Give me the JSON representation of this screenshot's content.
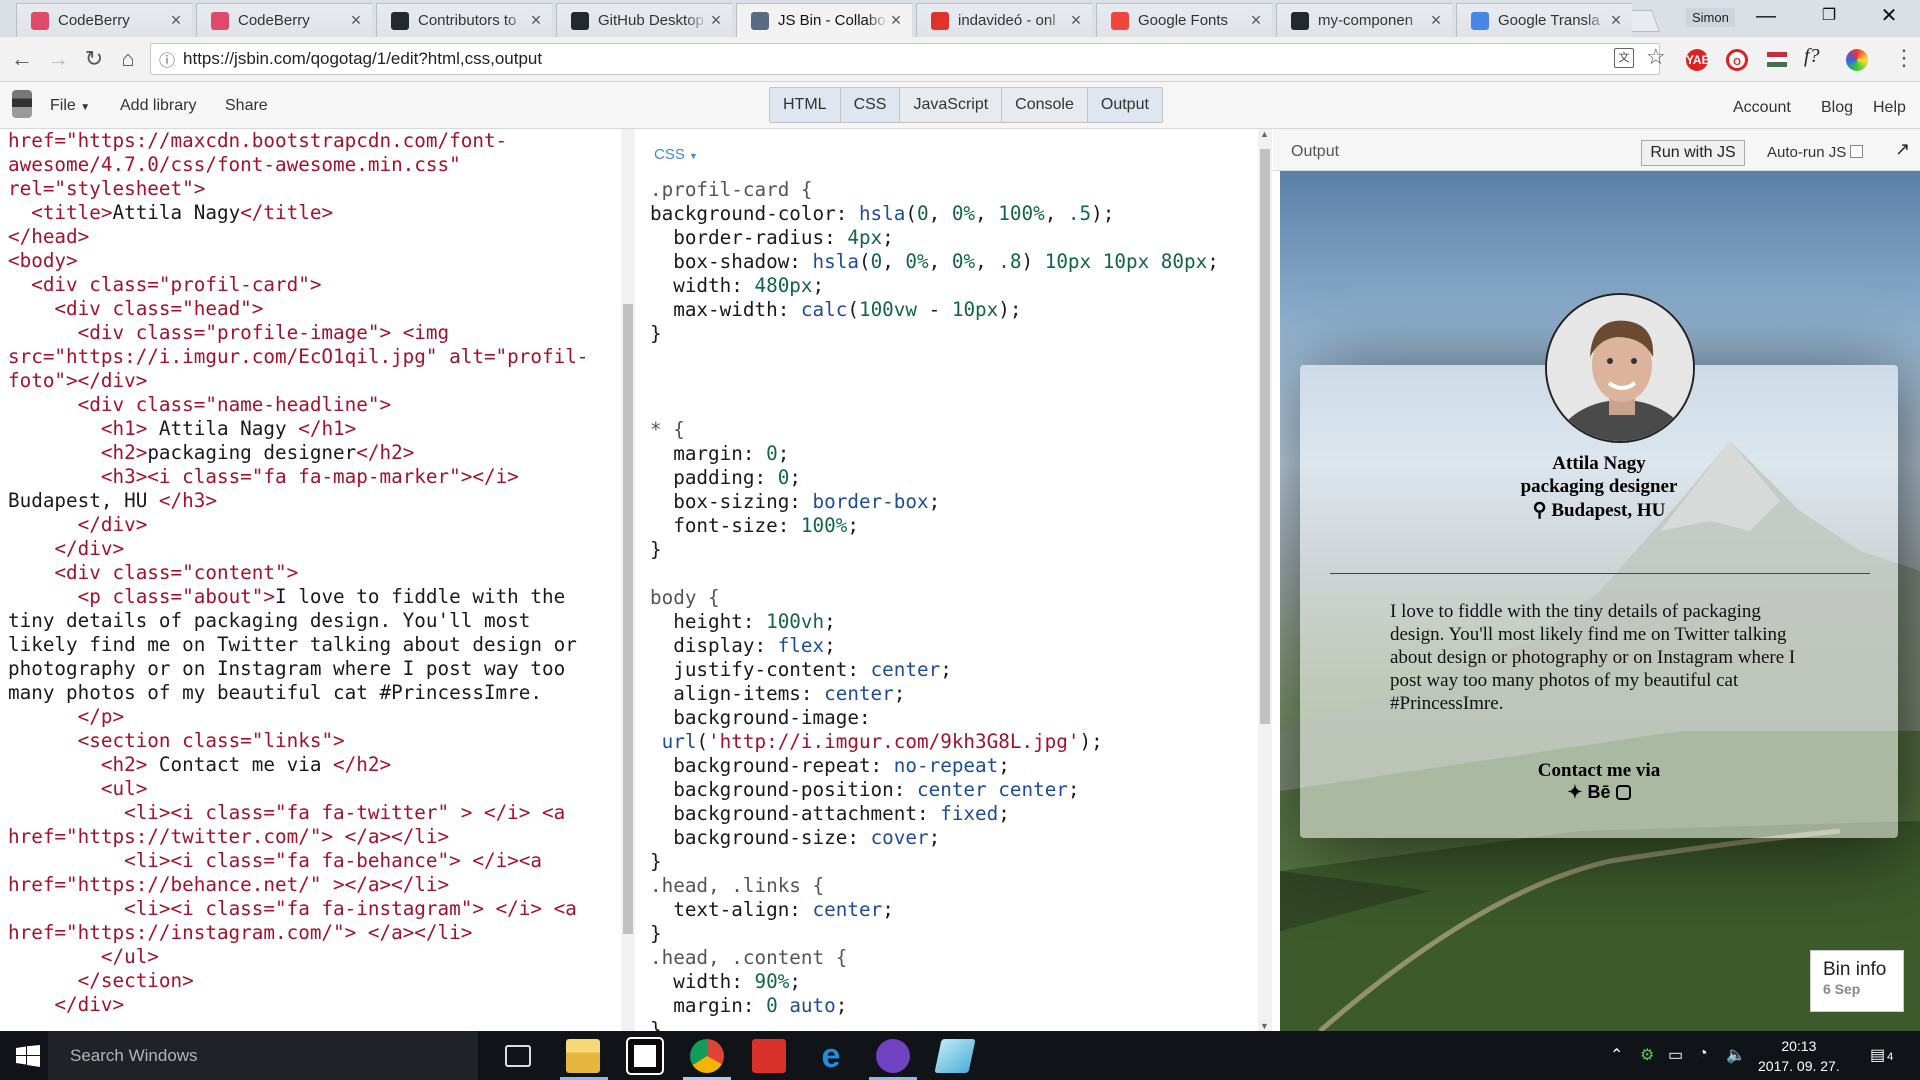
{
  "browser": {
    "tabs": [
      {
        "label": "CodeBerry",
        "icon": "codeberry-icon",
        "color": "#e04a6a"
      },
      {
        "label": "CodeBerry",
        "icon": "codeberry-icon",
        "color": "#e04a6a"
      },
      {
        "label": "Contributors to",
        "icon": "github-icon",
        "color": "#24292e"
      },
      {
        "label": "GitHub Desktop",
        "icon": "github-icon",
        "color": "#24292e"
      },
      {
        "label": "JS Bin - Collabo",
        "icon": "jsbin-icon",
        "color": "#5a6a80"
      },
      {
        "label": "indavideó - onl",
        "icon": "indavideo-icon",
        "color": "#e0312b"
      },
      {
        "label": "Google Fonts",
        "icon": "google-fonts-icon",
        "color": "#f0463c"
      },
      {
        "label": "my-componen",
        "icon": "github-icon",
        "color": "#24292e"
      },
      {
        "label": "Google Transla",
        "icon": "google-translate-icon",
        "color": "#4a86e8"
      }
    ],
    "user": "Simon",
    "url": "https://jsbin.com/qogotag/1/edit?html,css,output"
  },
  "jsbin": {
    "menu": {
      "file": "File",
      "add_library": "Add library",
      "share": "Share"
    },
    "panels": [
      "HTML",
      "CSS",
      "JavaScript",
      "Console",
      "Output"
    ],
    "right_links": {
      "account": "Account",
      "blog": "Blog",
      "help": "Help"
    },
    "css_label": "CSS",
    "output_label": "Output",
    "run_button": "Run with JS",
    "autorun_label": "Auto-run JS"
  },
  "html_code": [
    [
      [
        "a",
        "href=\"https://maxcdn.bootstrapcdn.com/font-"
      ]
    ],
    [
      [
        "s",
        "awesome/4.7.0/css/font-awesome.min.css\""
      ]
    ],
    [
      [
        "a",
        "rel=\"stylesheet\">"
      ]
    ],
    [
      [
        "t",
        "  <title>"
      ],
      [
        "x",
        "Attila Nagy"
      ],
      [
        "t",
        "</title>"
      ]
    ],
    [
      [
        "t",
        "</head>"
      ]
    ],
    [
      [
        "t",
        "<body>"
      ]
    ],
    [
      [
        "t",
        "  <div "
      ],
      [
        "a",
        "class=\"profil-card\">"
      ]
    ],
    [
      [
        "t",
        "    <div "
      ],
      [
        "a",
        "class=\"head\">"
      ]
    ],
    [
      [
        "t",
        "      <div "
      ],
      [
        "a",
        "class=\"profile-image\">"
      ],
      [
        "t",
        " <img"
      ]
    ],
    [
      [
        "a",
        "src=\"https://i.imgur.com/EcO1qil.jpg\" alt=\"profil-"
      ]
    ],
    [
      [
        "s",
        "foto\"></div>"
      ]
    ],
    [
      [
        "t",
        "      <div "
      ],
      [
        "a",
        "class=\"name-headline\">"
      ]
    ],
    [
      [
        "t",
        "        <h1>"
      ],
      [
        "x",
        " Attila Nagy "
      ],
      [
        "t",
        "</h1>"
      ]
    ],
    [
      [
        "t",
        "        <h2>"
      ],
      [
        "x",
        "packaging designer"
      ],
      [
        "t",
        "</h2>"
      ]
    ],
    [
      [
        "t",
        "        <h3><i "
      ],
      [
        "a",
        "class=\"fa fa-map-marker\">"
      ],
      [
        "t",
        "</i>"
      ]
    ],
    [
      [
        "x",
        "Budapest, HU "
      ],
      [
        "t",
        "</h3>"
      ]
    ],
    [
      [
        "t",
        "      </div>"
      ]
    ],
    [
      [
        "t",
        "    </div>"
      ]
    ],
    [
      [
        "t",
        "    <div "
      ],
      [
        "a",
        "class=\"content\">"
      ]
    ],
    [
      [
        "t",
        "      <p "
      ],
      [
        "a",
        "class=\"about\">"
      ],
      [
        "x",
        "I love to fiddle with the"
      ]
    ],
    [
      [
        "x",
        "tiny details of packaging design. You'll most"
      ]
    ],
    [
      [
        "x",
        "likely find me on Twitter talking about design or"
      ]
    ],
    [
      [
        "x",
        "photography or on Instagram where I post way too"
      ]
    ],
    [
      [
        "x",
        "many photos of my beautiful cat #PrincessImre."
      ]
    ],
    [
      [
        "t",
        "      </p>"
      ]
    ],
    [
      [
        "t",
        "      <section "
      ],
      [
        "a",
        "class=\"links\">"
      ]
    ],
    [
      [
        "t",
        "        <h2>"
      ],
      [
        "x",
        " Contact me via "
      ],
      [
        "t",
        "</h2>"
      ]
    ],
    [
      [
        "t",
        "        <ul>"
      ]
    ],
    [
      [
        "t",
        "          <li><i "
      ],
      [
        "a",
        "class=\"fa fa-twitter\""
      ],
      [
        "t",
        " > </i> <a"
      ]
    ],
    [
      [
        "a",
        "href=\"https://twitter.com/\">"
      ],
      [
        "t",
        " </a></li>"
      ]
    ],
    [
      [
        "t",
        "          <li><i "
      ],
      [
        "a",
        "class=\"fa fa-behance\">"
      ],
      [
        "t",
        " </i><a"
      ]
    ],
    [
      [
        "a",
        "href=\"https://behance.net/\""
      ],
      [
        "t",
        " ></a></li>"
      ]
    ],
    [
      [
        "t",
        "          <li><i "
      ],
      [
        "a",
        "class=\"fa fa-instagram\">"
      ],
      [
        "t",
        " </i> <a"
      ]
    ],
    [
      [
        "a",
        "href=\"https://instagram.com/\">"
      ],
      [
        "t",
        " </a></li>"
      ]
    ],
    [
      [
        "t",
        "        </ul>"
      ]
    ],
    [
      [
        "t",
        "      </section>"
      ]
    ],
    [
      [
        "t",
        "    </div>"
      ]
    ]
  ],
  "css_code": [
    [
      [
        "s",
        ".profil-card {"
      ]
    ],
    [
      [
        "p",
        "background-color: "
      ],
      [
        "v",
        "hsla"
      ],
      [
        "p",
        "("
      ],
      [
        "n",
        "0"
      ],
      [
        "p",
        ", "
      ],
      [
        "n",
        "0%"
      ],
      [
        "p",
        ", "
      ],
      [
        "n",
        "100%"
      ],
      [
        "p",
        ", "
      ],
      [
        "n",
        ".5"
      ],
      [
        "p",
        ");"
      ]
    ],
    [
      [
        "p",
        "  border-radius: "
      ],
      [
        "n",
        "4px"
      ],
      [
        "p",
        ";"
      ]
    ],
    [
      [
        "p",
        "  box-shadow: "
      ],
      [
        "v",
        "hsla"
      ],
      [
        "p",
        "("
      ],
      [
        "n",
        "0"
      ],
      [
        "p",
        ", "
      ],
      [
        "n",
        "0%"
      ],
      [
        "p",
        ", "
      ],
      [
        "n",
        "0%"
      ],
      [
        "p",
        ", "
      ],
      [
        "n",
        ".8"
      ],
      [
        "p",
        ") "
      ],
      [
        "n",
        "10px 10px 80px"
      ],
      [
        "p",
        ";"
      ]
    ],
    [
      [
        "p",
        "  width: "
      ],
      [
        "n",
        "480px"
      ],
      [
        "p",
        ";"
      ]
    ],
    [
      [
        "p",
        "  max-width: "
      ],
      [
        "v",
        "calc"
      ],
      [
        "p",
        "("
      ],
      [
        "n",
        "100vw"
      ],
      [
        "p",
        " - "
      ],
      [
        "n",
        "10px"
      ],
      [
        "p",
        ");"
      ]
    ],
    [
      [
        "p",
        "}"
      ]
    ],
    [
      [
        "p",
        ""
      ]
    ],
    [
      [
        "p",
        ""
      ]
    ],
    [
      [
        "p",
        ""
      ]
    ],
    [
      [
        "s",
        "* {"
      ]
    ],
    [
      [
        "p",
        "  margin: "
      ],
      [
        "n",
        "0"
      ],
      [
        "p",
        ";"
      ]
    ],
    [
      [
        "p",
        "  padding: "
      ],
      [
        "n",
        "0"
      ],
      [
        "p",
        ";"
      ]
    ],
    [
      [
        "p",
        "  box-sizing: "
      ],
      [
        "v",
        "border-box"
      ],
      [
        "p",
        ";"
      ]
    ],
    [
      [
        "p",
        "  font-size: "
      ],
      [
        "n",
        "100%"
      ],
      [
        "p",
        ";"
      ]
    ],
    [
      [
        "p",
        "}"
      ]
    ],
    [
      [
        "p",
        ""
      ]
    ],
    [
      [
        "s",
        "body {"
      ]
    ],
    [
      [
        "p",
        "  height: "
      ],
      [
        "n",
        "100vh"
      ],
      [
        "p",
        ";"
      ]
    ],
    [
      [
        "p",
        "  display: "
      ],
      [
        "v",
        "flex"
      ],
      [
        "p",
        ";"
      ]
    ],
    [
      [
        "p",
        "  justify-content: "
      ],
      [
        "v",
        "center"
      ],
      [
        "p",
        ";"
      ]
    ],
    [
      [
        "p",
        "  align-items: "
      ],
      [
        "v",
        "center"
      ],
      [
        "p",
        ";"
      ]
    ],
    [
      [
        "p",
        "  background-image:"
      ]
    ],
    [
      [
        "p",
        " "
      ],
      [
        "v",
        "url"
      ],
      [
        "p",
        "("
      ],
      [
        "r",
        "'http://i.imgur.com/9kh3G8L.jpg'"
      ],
      [
        "p",
        ");"
      ]
    ],
    [
      [
        "p",
        "  background-repeat: "
      ],
      [
        "v",
        "no-repeat"
      ],
      [
        "p",
        ";"
      ]
    ],
    [
      [
        "p",
        "  background-position: "
      ],
      [
        "v",
        "center center"
      ],
      [
        "p",
        ";"
      ]
    ],
    [
      [
        "p",
        "  background-attachment: "
      ],
      [
        "v",
        "fixed"
      ],
      [
        "p",
        ";"
      ]
    ],
    [
      [
        "p",
        "  background-size: "
      ],
      [
        "v",
        "cover"
      ],
      [
        "p",
        ";"
      ]
    ],
    [
      [
        "p",
        "}"
      ]
    ],
    [
      [
        "s",
        ".head, .links {"
      ]
    ],
    [
      [
        "p",
        "  text-align: "
      ],
      [
        "v",
        "center"
      ],
      [
        "p",
        ";"
      ]
    ],
    [
      [
        "p",
        "}"
      ]
    ],
    [
      [
        "s",
        ".head, .content {"
      ]
    ],
    [
      [
        "p",
        "  width: "
      ],
      [
        "n",
        "90%"
      ],
      [
        "p",
        ";"
      ]
    ],
    [
      [
        "p",
        "  margin: "
      ],
      [
        "n",
        "0"
      ],
      [
        "p",
        " "
      ],
      [
        "v",
        "auto"
      ],
      [
        "p",
        ";"
      ]
    ],
    [
      [
        "p",
        "}"
      ]
    ]
  ],
  "output": {
    "name": "Attila Nagy",
    "headline": "packaging designer",
    "location": "Budapest, HU",
    "about": "I love to fiddle with the tiny details of packaging design. You'll most likely find me on Twitter talking about design or photography or on Instagram where I post way too many photos of my beautiful cat #PrincessImre.",
    "contact_title": "Contact me via",
    "links": [
      "twitter-icon",
      "behance-icon",
      "instagram-icon"
    ],
    "behance_text": "Bē",
    "bin_info": {
      "title": "Bin info",
      "date": "6 Sep"
    }
  },
  "taskbar": {
    "search_placeholder": "Search Windows",
    "time": "20:13",
    "date": "2017. 09. 27.",
    "notification_count": "4"
  }
}
